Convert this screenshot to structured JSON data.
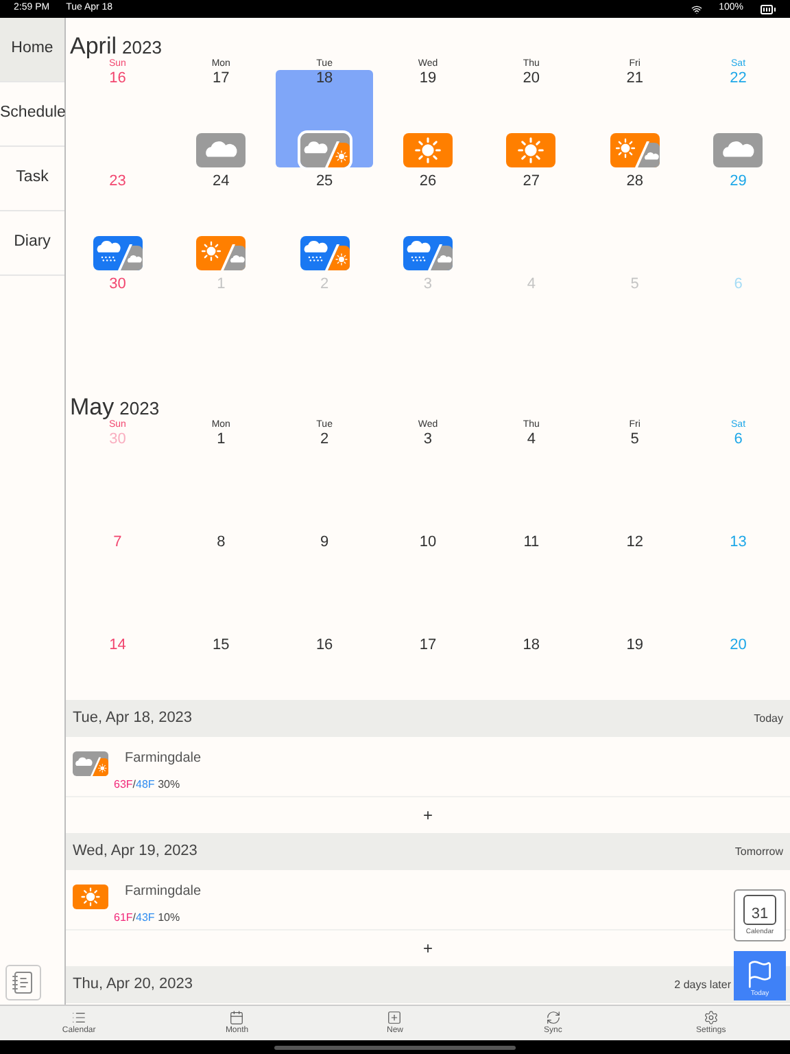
{
  "status_bar": {
    "time": "2:59 PM",
    "date": "Tue Apr 18",
    "battery": "100%"
  },
  "sidebar": {
    "items": [
      {
        "label": "Home",
        "selected": true
      },
      {
        "label": "Schedule",
        "selected": false
      },
      {
        "label": "Task",
        "selected": false
      },
      {
        "label": "Diary",
        "selected": false
      }
    ]
  },
  "months": [
    {
      "name": "April",
      "year": "2023",
      "weekdays": [
        {
          "label": "Sun",
          "color": "#f2466f"
        },
        {
          "label": "Mon",
          "color": "#333333"
        },
        {
          "label": "Tue",
          "color": "#333333"
        },
        {
          "label": "Wed",
          "color": "#333333"
        },
        {
          "label": "Thu",
          "color": "#333333"
        },
        {
          "label": "Fri",
          "color": "#333333"
        },
        {
          "label": "Sat",
          "color": "#1ea7e8"
        }
      ],
      "weeks": [
        [
          {
            "label": "16",
            "color": "#f2466f",
            "selected": false
          },
          {
            "label": "17",
            "color": "#333333",
            "selected": false,
            "forecast": {
              "kind": "cloudy"
            }
          },
          {
            "label": "18",
            "color": "#333333",
            "selected": true,
            "forecast": {
              "kind": "cloudy-sunny"
            }
          },
          {
            "label": "19",
            "color": "#333333",
            "selected": false,
            "forecast": {
              "kind": "sunny"
            }
          },
          {
            "label": "20",
            "color": "#333333",
            "selected": false,
            "forecast": {
              "kind": "sunny"
            }
          },
          {
            "label": "21",
            "color": "#333333",
            "selected": false,
            "forecast": {
              "kind": "sunny-cloudy"
            }
          },
          {
            "label": "22",
            "color": "#1ea7e8",
            "selected": false,
            "forecast": {
              "kind": "cloudy"
            }
          }
        ],
        [
          {
            "label": "23",
            "color": "#f2466f",
            "selected": false,
            "forecast": {
              "kind": "rainy-cloudy"
            }
          },
          {
            "label": "24",
            "color": "#333333",
            "selected": false,
            "forecast": {
              "kind": "sunny-cloudy"
            }
          },
          {
            "label": "25",
            "color": "#333333",
            "selected": false,
            "forecast": {
              "kind": "rainy-sunny"
            }
          },
          {
            "label": "26",
            "color": "#333333",
            "selected": false,
            "forecast": {
              "kind": "rainy-cloudy"
            }
          },
          {
            "label": "27",
            "color": "#333333",
            "selected": false
          },
          {
            "label": "28",
            "color": "#333333",
            "selected": false
          },
          {
            "label": "29",
            "color": "#1ea7e8",
            "selected": false
          }
        ],
        [
          {
            "label": "30",
            "color": "#f2466f",
            "selected": false
          },
          {
            "label": "1",
            "color": "#c4c4c4",
            "selected": false
          },
          {
            "label": "2",
            "color": "#c4c4c4",
            "selected": false
          },
          {
            "label": "3",
            "color": "#c4c4c4",
            "selected": false
          },
          {
            "label": "4",
            "color": "#c4c4c4",
            "selected": false
          },
          {
            "label": "5",
            "color": "#c4c4c4",
            "selected": false
          },
          {
            "label": "6",
            "color": "#a6dcf6",
            "selected": false
          }
        ]
      ]
    },
    {
      "name": "May",
      "year": "2023",
      "weekdays": [
        {
          "label": "Sun",
          "color": "#f2466f"
        },
        {
          "label": "Mon",
          "color": "#333333"
        },
        {
          "label": "Tue",
          "color": "#333333"
        },
        {
          "label": "Wed",
          "color": "#333333"
        },
        {
          "label": "Thu",
          "color": "#333333"
        },
        {
          "label": "Fri",
          "color": "#333333"
        },
        {
          "label": "Sat",
          "color": "#1ea7e8"
        }
      ],
      "weeks": [
        [
          {
            "label": "30",
            "color": "#f9aec0",
            "selected": false
          },
          {
            "label": "1",
            "color": "#333333",
            "selected": false
          },
          {
            "label": "2",
            "color": "#333333",
            "selected": false
          },
          {
            "label": "3",
            "color": "#333333",
            "selected": false
          },
          {
            "label": "4",
            "color": "#333333",
            "selected": false
          },
          {
            "label": "5",
            "color": "#333333",
            "selected": false
          },
          {
            "label": "6",
            "color": "#1ea7e8",
            "selected": false
          }
        ],
        [
          {
            "label": "7",
            "color": "#f2466f",
            "selected": false
          },
          {
            "label": "8",
            "color": "#333333",
            "selected": false
          },
          {
            "label": "9",
            "color": "#333333",
            "selected": false
          },
          {
            "label": "10",
            "color": "#333333",
            "selected": false
          },
          {
            "label": "11",
            "color": "#333333",
            "selected": false
          },
          {
            "label": "12",
            "color": "#333333",
            "selected": false
          },
          {
            "label": "13",
            "color": "#1ea7e8",
            "selected": false
          }
        ],
        [
          {
            "label": "14",
            "color": "#f2466f",
            "selected": false
          },
          {
            "label": "15",
            "color": "#333333",
            "selected": false
          },
          {
            "label": "16",
            "color": "#333333",
            "selected": false
          },
          {
            "label": "17",
            "color": "#333333",
            "selected": false
          },
          {
            "label": "18",
            "color": "#333333",
            "selected": false
          },
          {
            "label": "19",
            "color": "#333333",
            "selected": false
          },
          {
            "label": "20",
            "color": "#1ea7e8",
            "selected": false
          }
        ]
      ]
    }
  ],
  "agenda": [
    {
      "date": "Tue, Apr 18, 2023",
      "relative": "Today",
      "entries": [
        {
          "forecast": {
            "kind": "cloudy-sunny"
          },
          "location": "Farmingdale",
          "high": "63F",
          "separator": "/",
          "low": "48F",
          "precip": "30%"
        }
      ],
      "add": "+"
    },
    {
      "date": "Wed, Apr 19, 2023",
      "relative": "Tomorrow",
      "entries": [
        {
          "forecast": {
            "kind": "sunny"
          },
          "location": "Farmingdale",
          "high": "61F",
          "separator": "/",
          "low": "43F",
          "precip": "10%"
        }
      ],
      "add": "+"
    },
    {
      "date": "Thu, Apr 20, 2023",
      "relative": "2 days later"
    }
  ],
  "floating": {
    "calendar": {
      "day": "31",
      "label": "Calendar"
    },
    "today": {
      "label": "Today"
    }
  },
  "tab_bar": [
    {
      "label": "Calendar"
    },
    {
      "label": "Month"
    },
    {
      "label": "New"
    },
    {
      "label": "Sync"
    },
    {
      "label": "Settings"
    }
  ]
}
